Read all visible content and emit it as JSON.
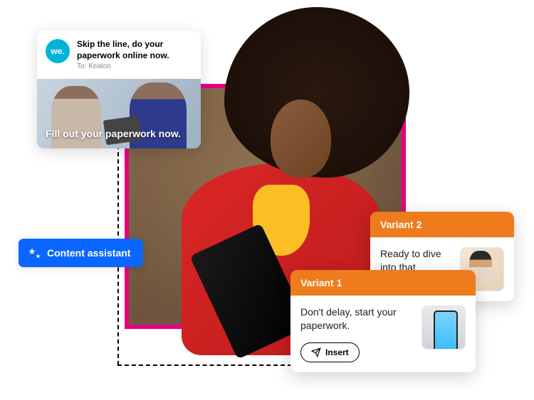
{
  "colors": {
    "accent_pink": "#e6007e",
    "accent_blue": "#0a66ff",
    "accent_orange": "#ee7c1c",
    "brand_cyan": "#00b4d8"
  },
  "notification": {
    "brand_badge": "we.",
    "headline": "Skip the line, do your paperwork online now.",
    "to_prefix": "To:",
    "to_name": "Keaton",
    "image_overlay": "Fill out your paperwork now."
  },
  "content_assistant": {
    "label": "Content assistant"
  },
  "variants": [
    {
      "title": "Variant 1",
      "body": "Don't delay, start your paperwork.",
      "insert_label": "Insert",
      "thumb": "phone-checklist"
    },
    {
      "title": "Variant 2",
      "body": "Ready to dive into that paperwork?",
      "thumb": "person-writing"
    }
  ]
}
